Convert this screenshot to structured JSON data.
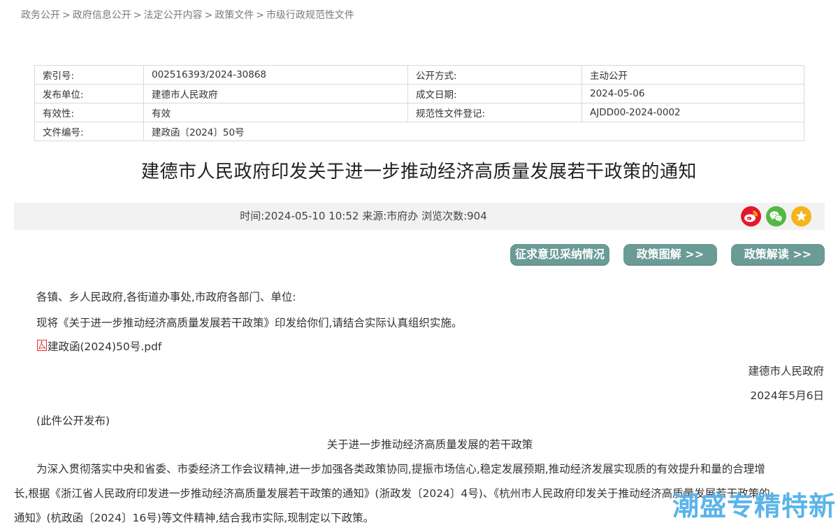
{
  "breadcrumb": {
    "items": [
      "政务公开",
      "政府信息公开",
      "法定公开内容",
      "政策文件",
      "市级行政规范性文件"
    ],
    "separator": ">"
  },
  "meta_table": {
    "rows": [
      {
        "k1": "索引号:",
        "v1": "002516393/2024-30868",
        "k2": "公开方式:",
        "v2": "主动公开"
      },
      {
        "k1": "发布单位:",
        "v1": "建德市人民政府",
        "k2": "成文日期:",
        "v2": "2024-05-06"
      },
      {
        "k1": "有效性:",
        "v1": "有效",
        "k2": "规范性文件登记:",
        "v2": "AJDD00-2024-0002"
      },
      {
        "k1": "文件编号:",
        "v1": "建政函〔2024〕50号"
      }
    ]
  },
  "title": "建德市人民政府印发关于进一步推动经济高质量发展若干政策的通知",
  "info": {
    "time_label": "时间:",
    "time": "2024-05-10 10:52",
    "source_label": "来源:",
    "source": "市府办",
    "views_label": "浏览次数:",
    "views": "904"
  },
  "share_icons": [
    "weibo-icon",
    "wechat-icon",
    "favorite-star-icon"
  ],
  "colors": {
    "button_bg": "#6b9b95",
    "weibo": "#e6162d",
    "wechat": "#51b843",
    "star": "#f4b41a",
    "watermark": "#5ab4ea"
  },
  "buttons": {
    "opinion": "征求意见采纳情况",
    "graphic": "政策图解 >>",
    "interpret": "政策解读 >>"
  },
  "body": {
    "salutation": "各镇、乡人民政府,各街道办事处,市政府各部门、单位:",
    "intro": "现将《关于进一步推动经济高质量发展若干政策》印发给你们,请结合实际认真组织实施。",
    "attachment": "建政函(2024)50号.pdf",
    "signature": "建德市人民政府",
    "date": "2024年5月6日",
    "release_note": "(此件公开发布)",
    "policy_title": "关于进一步推动经济高质量发展的若干政策",
    "para_line1": "为深入贯彻落实中央和省委、市委经济工作会议精神,进一步加强各类政策协同,提振市场信心,稳定发展预期,推动经济发展实现质的有效提升和量的合理增",
    "para_line2": "长,根据《浙江省人民政府印发进一步推动经济高质量发展若干政策的通知》(浙政发〔2024〕4号)、《杭州市人民政府印发关于推动经济高质量发展若干政策的",
    "para_line3": "通知》(杭政函〔2024〕16号)等文件精神,结合我市实际,现制定以下政策。"
  },
  "watermark": "潮盛专精特新"
}
